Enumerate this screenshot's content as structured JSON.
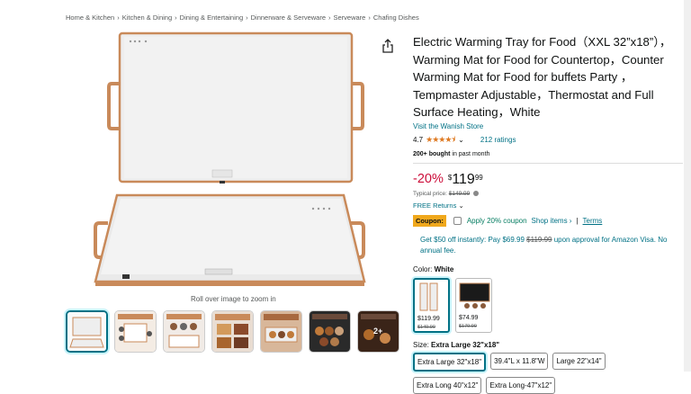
{
  "breadcrumb": [
    "Home & Kitchen",
    "Kitchen & Dining",
    "Dining & Entertaining",
    "Dinnerware & Serveware",
    "Serveware",
    "Chafing Dishes"
  ],
  "breadcrumb_sep": "›",
  "zoom_hint": "Roll over image to zoom in",
  "product": {
    "title": "Electric Warming Tray for Food（XXL 32”x18”），Warming Mat for Food for Countertop，Counter Warming Mat for Food for buffets Party ，Tempmaster Adjustable，Thermostat and Full Surface Heating，White",
    "store": "Visit the Wanish Store",
    "rating": "4.7",
    "stars": "★★★★⯨",
    "rating_count": "212 ratings",
    "bought_bold": "200+ bought",
    "bought_rest": " in past month",
    "discount": "-20%",
    "price_symbol": "$",
    "price_whole": "119",
    "price_cents": "99",
    "typical_label": "Typical price: ",
    "typical_price": "$149.99",
    "returns": "FREE Returns",
    "coupon_badge": "Coupon:",
    "coupon_text": "Apply 20% coupon",
    "shop_items": "Shop items ›",
    "terms": "Terms",
    "offer_pre": "Get $50 off instantly: Pay $69.99 ",
    "offer_strike": "$119.99",
    "offer_post": " upon approval for Amazon Visa. No annual fee.",
    "color_label": "Color: ",
    "color_value": "White",
    "size_label": "Size: ",
    "size_value": "Extra Large 32\"x18\""
  },
  "color_options": [
    {
      "price": "$119.99",
      "list": "$149.99"
    },
    {
      "price": "$74.99",
      "list": "$179.99"
    }
  ],
  "sizes": [
    "Extra Large 32\"x18\"",
    "39.4\"L x 11.8\"W",
    "Large 22\"x14\"",
    "Extra Long 40\"x12\"",
    "Extra Long-47\"x12\""
  ],
  "thumb_badge": "2+",
  "colors": {
    "link": "#007185",
    "price_red": "#cc0c39",
    "star": "#de7921",
    "coupon": "#f0a81c",
    "copper": "#c98a5a"
  }
}
